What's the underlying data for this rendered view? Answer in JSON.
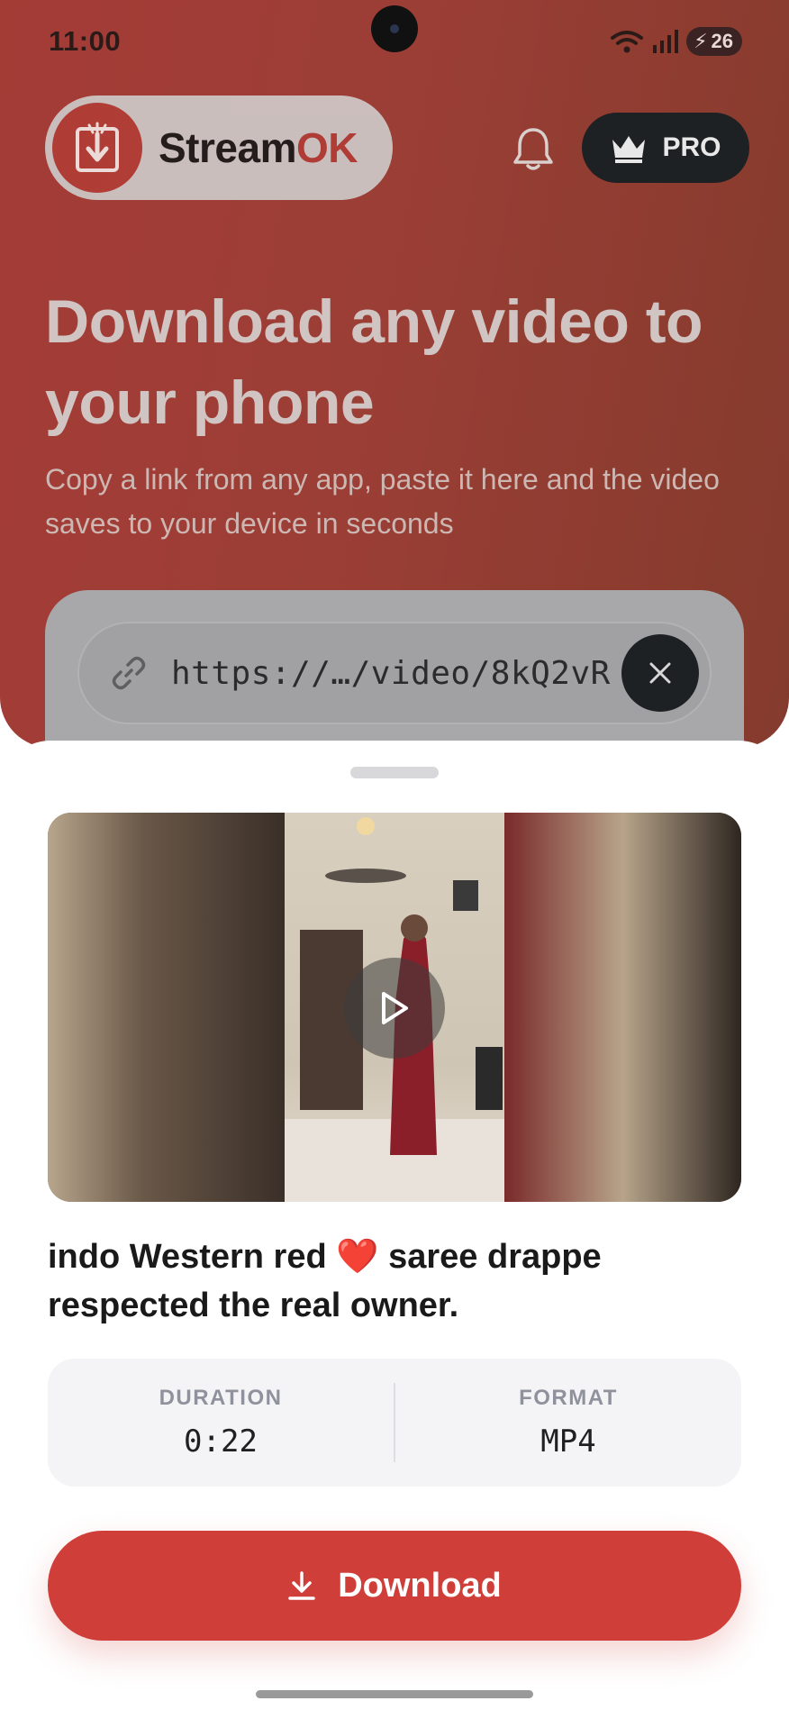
{
  "status_bar": {
    "time": "11:00",
    "battery": "26"
  },
  "header": {
    "brand_prefix": "Stream",
    "brand_suffix": "OK",
    "pro_label": "PRO"
  },
  "hero": {
    "headline": "Download any video to your phone",
    "subline": "Copy a link from any app, paste it here and the video saves to your device in seconds"
  },
  "link_input": {
    "value": "https://…/video/8kQ2vR"
  },
  "result": {
    "title": "indo Western red ❤️ saree drappe respected the real owner.",
    "duration_label": "DURATION",
    "duration_value": "0:22",
    "format_label": "FORMAT",
    "format_value": "MP4",
    "download_label": "Download"
  },
  "colors": {
    "accent": "#cf3e38",
    "hero_bg": "#b3413a",
    "dark": "#1e2124"
  },
  "icons": [
    "streamok-logo-icon",
    "bell-icon",
    "crown-icon",
    "link-icon",
    "close-icon",
    "play-icon",
    "download-icon"
  ]
}
